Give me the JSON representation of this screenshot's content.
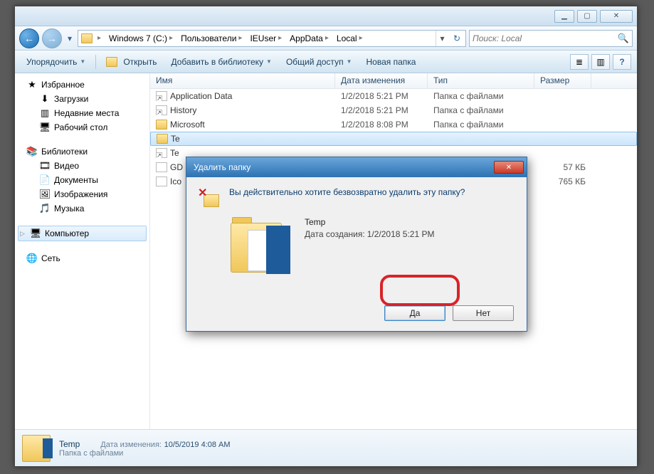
{
  "titlebar": {
    "min": "▁",
    "max": "▢",
    "close": "✕"
  },
  "nav": {
    "back": "←",
    "forward": "→",
    "dropdown": "▾",
    "refresh": "↻"
  },
  "breadcrumb": [
    "Windows 7 (C:)",
    "Пользователи",
    "IEUser",
    "AppData",
    "Local"
  ],
  "addr_dropdown": "▾",
  "search": {
    "placeholder": "Поиск: Local",
    "icon": "🔍"
  },
  "toolbar": {
    "organize": "Упорядочить",
    "open": "Открыть",
    "add_to_library": "Добавить в библиотеку",
    "share": "Общий доступ",
    "new_folder": "Новая папка",
    "view_icon": "≣",
    "help_icon": "?"
  },
  "sidebar": {
    "favorites": {
      "head": "Избранное",
      "items": [
        "Загрузки",
        "Недавние места",
        "Рабочий стол"
      ],
      "icons": [
        "⬇",
        "▥",
        "🖥"
      ]
    },
    "libraries": {
      "head": "Библиотеки",
      "items": [
        "Видео",
        "Документы",
        "Изображения",
        "Музыка"
      ],
      "icons": [
        "🎞",
        "📄",
        "🖼",
        "🎵"
      ]
    },
    "computer": {
      "head": "Компьютер",
      "icon": "🖥"
    },
    "network": {
      "head": "Сеть",
      "icon": "🌐"
    }
  },
  "columns": {
    "name": "Имя",
    "modified": "Дата изменения",
    "type": "Тип",
    "size": "Размер",
    "w_name": 260,
    "w_mod": 130,
    "w_type": 150,
    "w_size": 80
  },
  "files": [
    {
      "icon": "shortcut",
      "name": "Application Data",
      "modified": "1/2/2018 5:21 PM",
      "type": "Папка с файлами",
      "size": ""
    },
    {
      "icon": "shortcut",
      "name": "History",
      "modified": "1/2/2018 5:21 PM",
      "type": "Папка с файлами",
      "size": ""
    },
    {
      "icon": "folder",
      "name": "Microsoft",
      "modified": "1/2/2018 8:08 PM",
      "type": "Папка с файлами",
      "size": ""
    },
    {
      "icon": "folder",
      "name": "Te",
      "modified": "",
      "type": "",
      "size": "",
      "selected": true
    },
    {
      "icon": "shortcut",
      "name": "Te",
      "modified": "",
      "type": "",
      "size": ""
    },
    {
      "icon": "file",
      "name": "GD",
      "modified": "",
      "type": "",
      "size": "57 КБ"
    },
    {
      "icon": "file",
      "name": "Ico",
      "modified": "",
      "type": "",
      "size": "765 КБ"
    }
  ],
  "details": {
    "name": "Temp",
    "type": "Папка с файлами",
    "modified_label": "Дата изменения:",
    "modified": "10/5/2019 4:08 AM"
  },
  "dialog": {
    "title": "Удалить папку",
    "question": "Вы действительно хотите безвозвратно удалить эту папку?",
    "item_name": "Temp",
    "created_label": "Дата создания:",
    "created": "1/2/2018 5:21 PM",
    "yes": "Да",
    "no": "Нет"
  }
}
